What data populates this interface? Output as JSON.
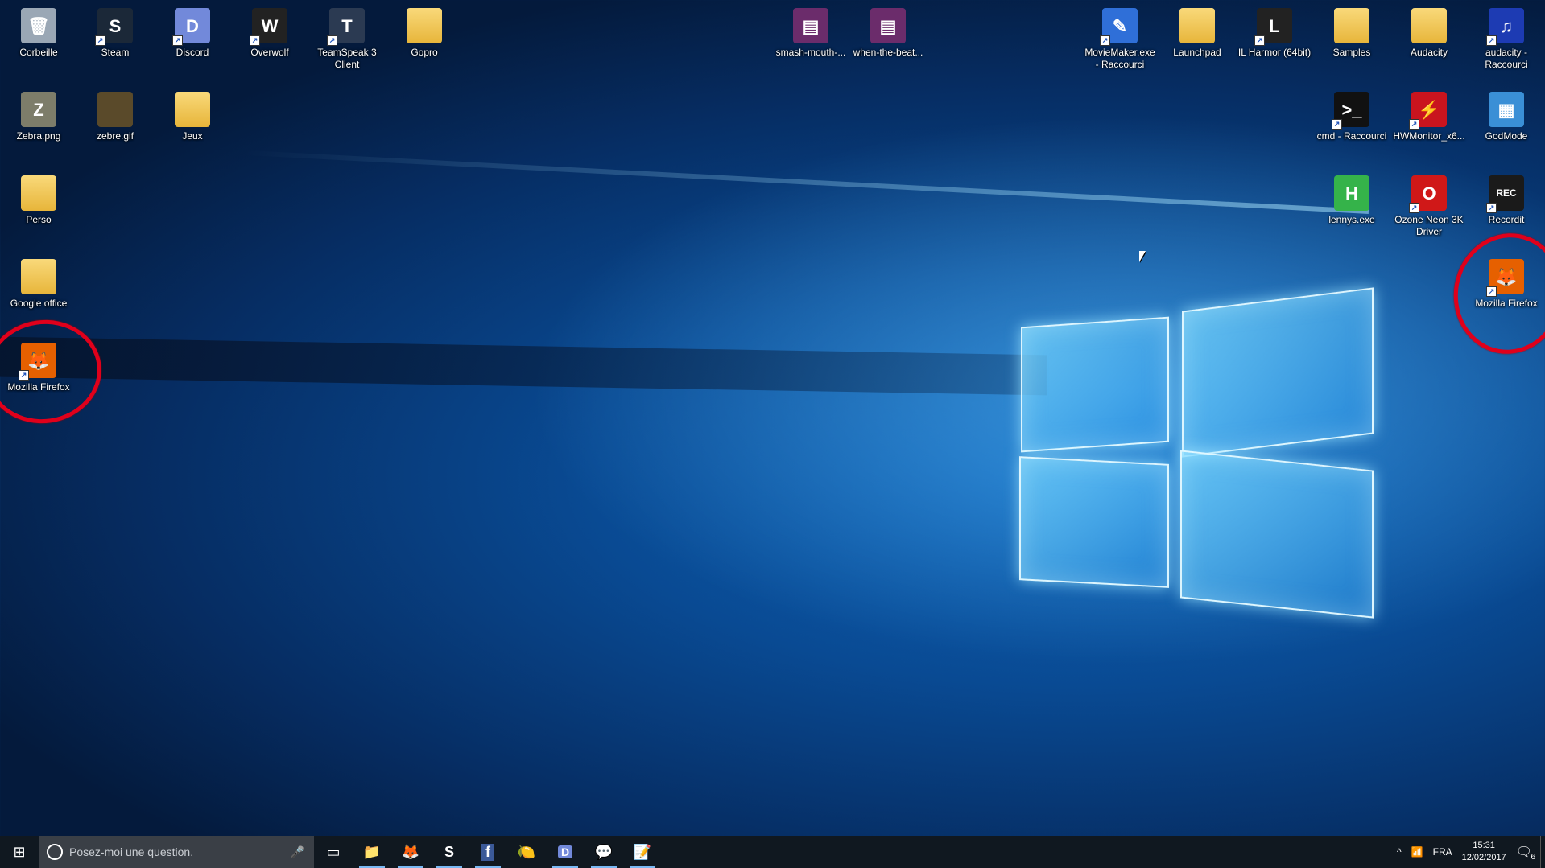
{
  "desktop": {
    "icons": [
      {
        "label": "Corbeille",
        "icon": "recycle-bin-icon",
        "glyph": "🗑",
        "color": "#9aa7b5"
      },
      {
        "label": "Steam",
        "icon": "steam-icon",
        "glyph": "S",
        "color": "#1b2838",
        "shortcut": true
      },
      {
        "label": "Discord",
        "icon": "discord-icon",
        "glyph": "D",
        "color": "#7289da",
        "shortcut": true
      },
      {
        "label": "Overwolf",
        "icon": "overwolf-icon",
        "glyph": "W",
        "color": "#222222",
        "shortcut": true
      },
      {
        "label": "TeamSpeak 3 Client",
        "icon": "teamspeak-icon",
        "glyph": "T",
        "color": "#2b3a52",
        "shortcut": true
      },
      {
        "label": "Gopro",
        "icon": "folder-icon",
        "glyph": "",
        "color": "folder"
      },
      {
        "label": "smash-mouth-...",
        "icon": "winrar-archive-icon",
        "glyph": "▤",
        "color": "#6b2c6b"
      },
      {
        "label": "when-the-beat...",
        "icon": "winrar-archive-icon",
        "glyph": "▤",
        "color": "#6b2c6b"
      },
      {
        "label": "MovieMaker.exe - Raccourci",
        "icon": "moviemaker-icon",
        "glyph": "✎",
        "color": "#2f6fd8",
        "shortcut": true
      },
      {
        "label": "Launchpad",
        "icon": "launchpad-folder-icon",
        "glyph": "",
        "color": "folder"
      },
      {
        "label": "IL Harmor (64bit)",
        "icon": "harmor-icon",
        "glyph": "L",
        "color": "#222222",
        "shortcut": true
      },
      {
        "label": "Samples",
        "icon": "samples-folder-icon",
        "glyph": "",
        "color": "folder"
      },
      {
        "label": "Audacity",
        "icon": "audacity-folder-icon",
        "glyph": "",
        "color": "folder"
      },
      {
        "label": "audacity - Raccourci",
        "icon": "audacity-icon",
        "glyph": "♫",
        "color": "#1d3bb3",
        "shortcut": true
      },
      {
        "label": "Zebra.png",
        "icon": "zebra-image-icon",
        "glyph": "Z",
        "color": "#7d7d6a"
      },
      {
        "label": "zebre.gif",
        "icon": "zebre-gif-icon",
        "glyph": "",
        "color": "#5a4a2a"
      },
      {
        "label": "Jeux",
        "icon": "folder-icon",
        "glyph": "",
        "color": "folder"
      },
      {
        "label": "cmd - Raccourci",
        "icon": "cmd-icon",
        "glyph": ">_",
        "color": "#111111",
        "shortcut": true
      },
      {
        "label": "HWMonitor_x6...",
        "icon": "hwmonitor-icon",
        "glyph": "⚡",
        "color": "#c9141e",
        "shortcut": true
      },
      {
        "label": "GodMode",
        "icon": "control-panel-icon",
        "glyph": "▦",
        "color": "#3a8fd6"
      },
      {
        "label": "Perso",
        "icon": "perso-folder-icon",
        "glyph": "",
        "color": "folder"
      },
      {
        "label": "lennys.exe",
        "icon": "lennys-icon",
        "glyph": "H",
        "color": "#35b34a"
      },
      {
        "label": "Ozone Neon 3K Driver",
        "icon": "ozone-icon",
        "glyph": "O",
        "color": "#d01818",
        "shortcut": true
      },
      {
        "label": "Recordit",
        "icon": "recordit-icon",
        "glyph": "REC",
        "color": "#1a1a1a",
        "shortcut": true
      },
      {
        "label": "Google office",
        "icon": "google-office-folder-icon",
        "glyph": "",
        "color": "folder"
      },
      {
        "label": "Mozilla Firefox",
        "icon": "firefox-icon",
        "glyph": "🦊",
        "color": "#e66000",
        "shortcut": true
      },
      {
        "label": "Mozilla Firefox",
        "icon": "firefox-icon",
        "glyph": "🦊",
        "color": "#e66000",
        "shortcut": true
      }
    ]
  },
  "annotations": {
    "color": "#e0001b"
  },
  "taskbar": {
    "start_glyph": "⊞",
    "search_placeholder": "Posez-moi une question.",
    "mic_glyph": "🎤",
    "pinned": [
      {
        "name": "task-view",
        "glyph": "▭"
      },
      {
        "name": "file-explorer",
        "glyph": "📁"
      },
      {
        "name": "firefox",
        "glyph": "🦊"
      },
      {
        "name": "steam",
        "glyph": "S"
      },
      {
        "name": "facebook",
        "glyph": "f"
      },
      {
        "name": "fl-studio",
        "glyph": "🍋"
      },
      {
        "name": "discord",
        "glyph": "D"
      },
      {
        "name": "messenger",
        "glyph": "💬"
      },
      {
        "name": "notepad",
        "glyph": "📝"
      }
    ],
    "tray": {
      "chevron": "^",
      "network": "📶",
      "language": "FRA",
      "time": "15:31",
      "date": "12/02/2017",
      "notifications_glyph": "🗨",
      "notification_count": "6"
    }
  }
}
